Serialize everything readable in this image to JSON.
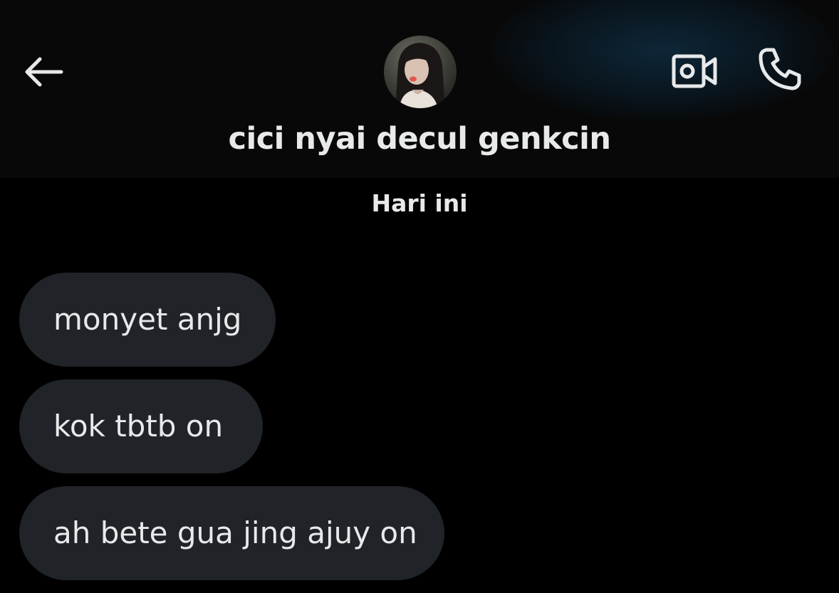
{
  "header": {
    "contact_name": "cici nyai decul genkcin",
    "back_icon": "arrow-left-icon",
    "video_icon": "video-camera-icon",
    "call_icon": "phone-icon",
    "glow_color": "#0e283a"
  },
  "conversation": {
    "date_divider": "Hari ini",
    "messages": [
      {
        "text": "monyet anjg",
        "direction": "incoming"
      },
      {
        "text": "kok tbtb on",
        "direction": "incoming"
      },
      {
        "text": "ah bete gua jing ajuy on",
        "direction": "incoming"
      }
    ]
  },
  "colors": {
    "background": "#000000",
    "header_background": "#080808",
    "bubble_background": "#202327",
    "text": "#e7e9ea"
  }
}
